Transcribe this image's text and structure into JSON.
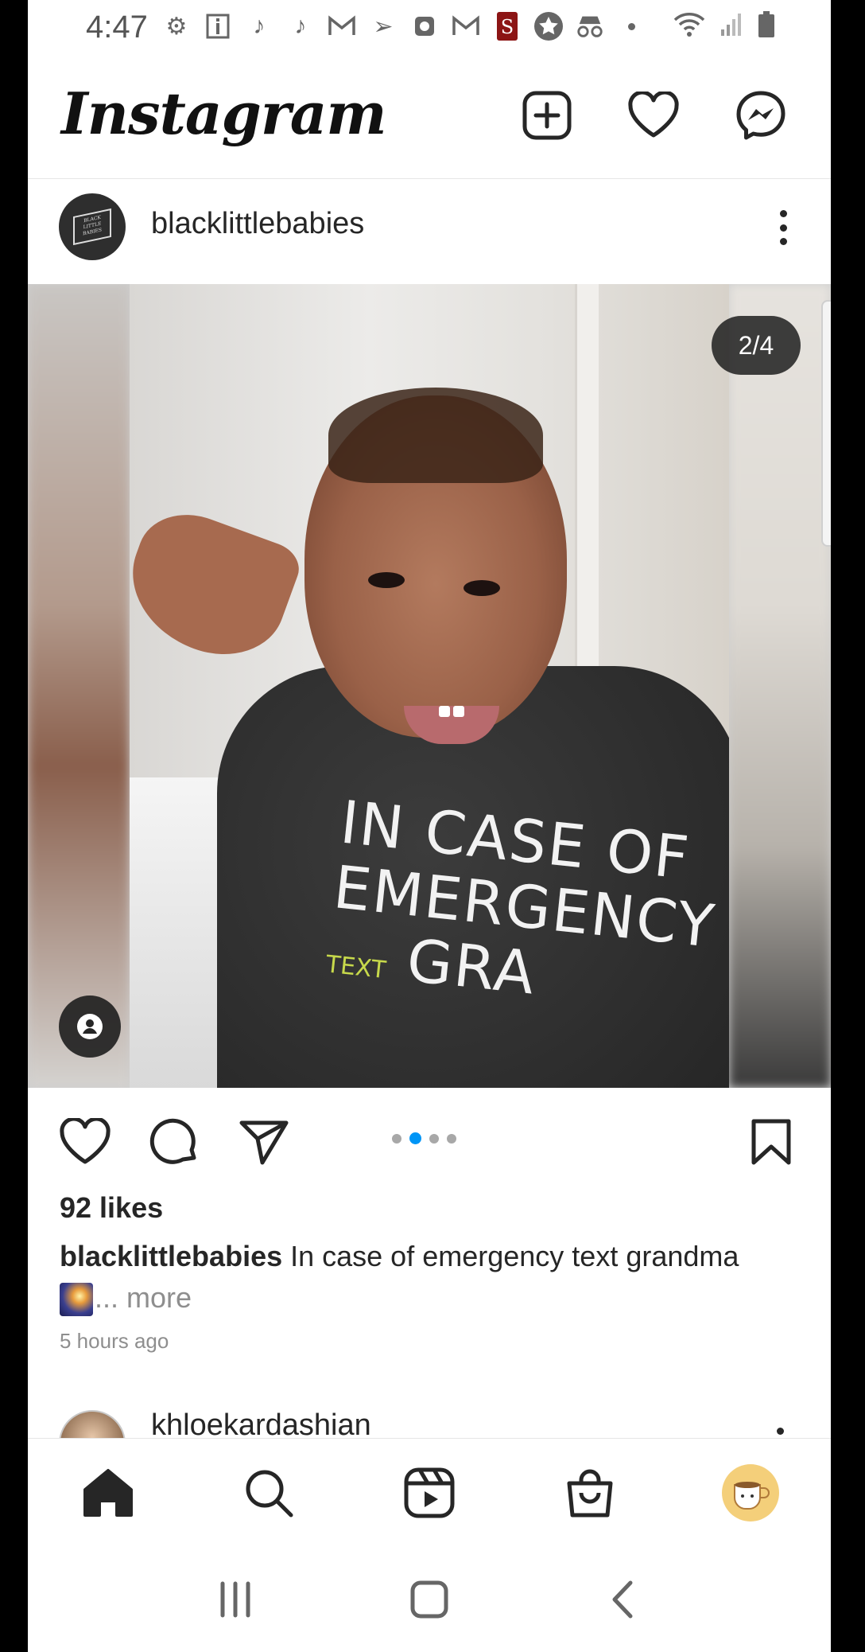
{
  "status_bar": {
    "time": "4:47",
    "icons": [
      "settings-icon",
      "info-icon",
      "tiktok-icon",
      "tiktok-icon",
      "gmail-icon",
      "delivery-icon",
      "alarm-icon",
      "gmail-icon",
      "stanford-icon",
      "star-icon",
      "incognito-icon",
      "dot-icon"
    ],
    "right_icons": [
      "wifi-icon",
      "signal-icon",
      "battery-icon"
    ]
  },
  "header": {
    "logo": "Instagram",
    "icons": [
      "new-post-icon",
      "activity-heart-icon",
      "messenger-icon"
    ]
  },
  "post": {
    "username": "blacklittlebabies",
    "avatar_text": "BLACK LITTLE BABIES",
    "carousel_counter": "2/4",
    "carousel_total": 4,
    "carousel_active_index": 2,
    "shirt_line1": "IN CASE OF",
    "shirt_line2": "EMERGENCY",
    "shirt_small": "TEXT",
    "shirt_line3": "GRA",
    "likes": "92 likes",
    "caption_user": "blacklittlebabies",
    "caption_text": " In case of emergency text grandma",
    "caption_more": "... more",
    "time_ago": "5 hours ago"
  },
  "next_post": {
    "username": "khloekardashian"
  },
  "bottom_nav": {
    "items": [
      "home-icon",
      "search-icon",
      "reels-icon",
      "shop-icon",
      "profile-avatar"
    ]
  },
  "colors": {
    "accent": "#0095f6",
    "text": "#262626",
    "muted": "#8e8e8e"
  }
}
